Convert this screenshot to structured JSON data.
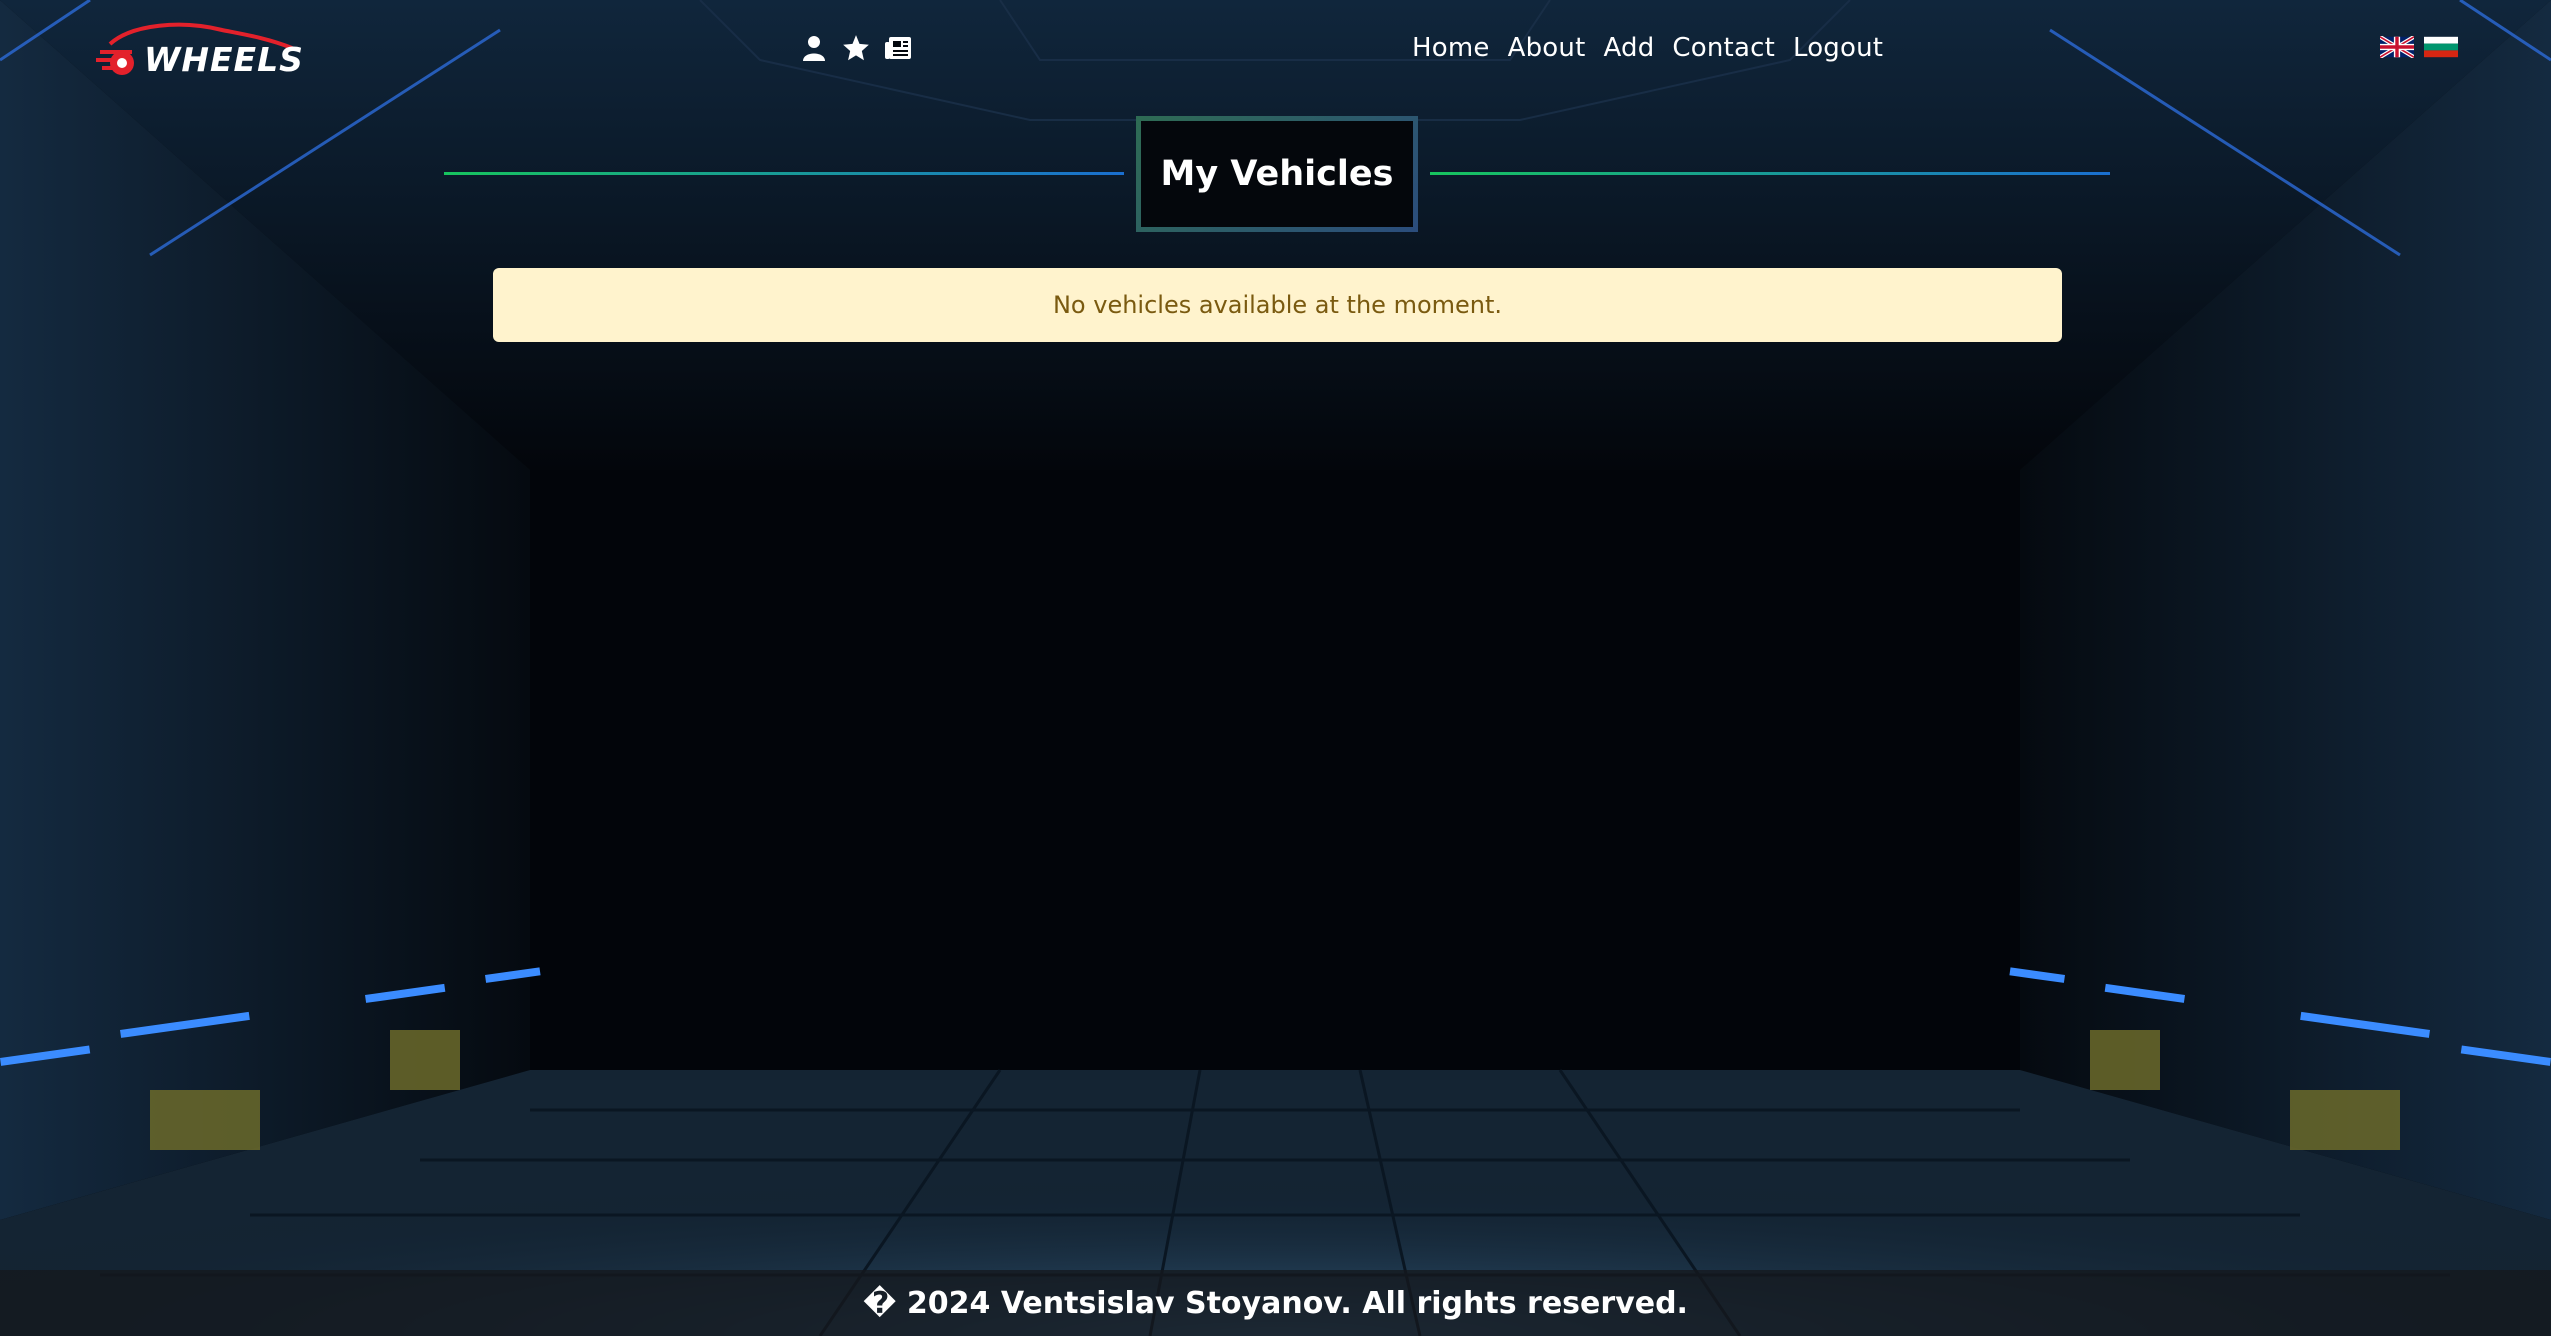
{
  "brand": {
    "name": "WHEELS",
    "accent": "#e3212b"
  },
  "header_icons": [
    {
      "name": "user-icon"
    },
    {
      "name": "star-icon"
    },
    {
      "name": "newspaper-icon"
    }
  ],
  "nav": {
    "items": [
      {
        "label": "Home"
      },
      {
        "label": "About"
      },
      {
        "label": "Add"
      },
      {
        "label": "Contact"
      },
      {
        "label": "Logout"
      }
    ]
  },
  "languages": [
    {
      "name": "uk-flag-icon"
    },
    {
      "name": "bulgaria-flag-icon"
    }
  ],
  "page": {
    "title": "My Vehicles",
    "empty_message": "No vehicles available at the moment."
  },
  "footer": {
    "text": "� 2024 Ventsislav Stoyanov. All rights reserved."
  },
  "colors": {
    "title_line_start": "#17c45e",
    "title_line_end": "#1a6fd0",
    "alert_bg": "#fff3cd",
    "alert_text": "#7a5a10"
  }
}
